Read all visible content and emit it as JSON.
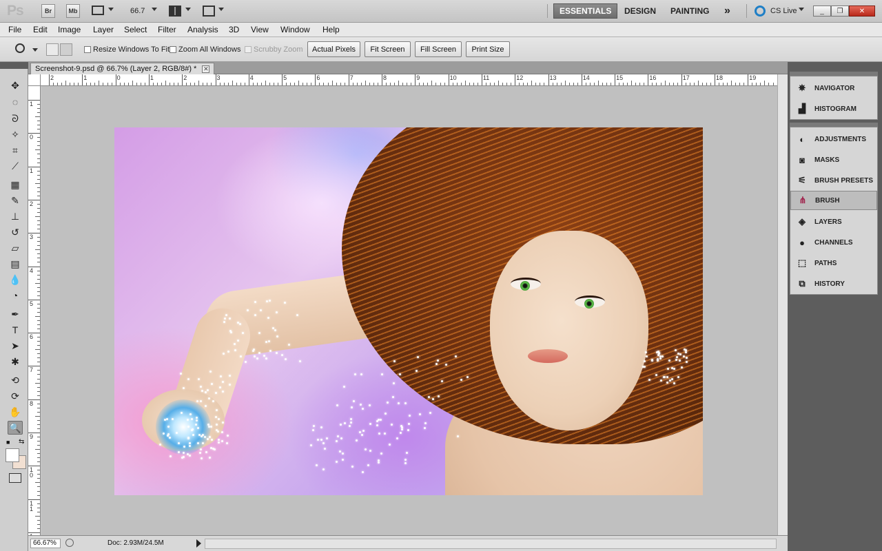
{
  "appbar": {
    "logo": "Ps",
    "bridge_label": "Br",
    "minibridge_label": "Mb",
    "zoom_value": "66.7",
    "workspaces": [
      "ESSENTIALS",
      "DESIGN",
      "PAINTING"
    ],
    "more_symbol": "»",
    "cslive_label": "CS Live"
  },
  "menu": [
    "File",
    "Edit",
    "Image",
    "Layer",
    "Select",
    "Filter",
    "Analysis",
    "3D",
    "View",
    "Window",
    "Help"
  ],
  "options": {
    "resize_windows": "Resize Windows To Fit",
    "zoom_all": "Zoom All Windows",
    "scrubby_zoom": "Scrubby Zoom",
    "actual_pixels": "Actual Pixels",
    "fit_screen": "Fit Screen",
    "fill_screen": "Fill Screen",
    "print_size": "Print Size"
  },
  "document": {
    "tab_title": "Screenshot-9.psd @ 66.7% (Layer 2, RGB/8#) *",
    "ruler_top": [
      "2",
      "1",
      "0",
      "1",
      "2",
      "3",
      "4",
      "5",
      "6",
      "7",
      "8",
      "9",
      "10",
      "11",
      "12",
      "13",
      "14",
      "15",
      "16",
      "17",
      "18",
      "19"
    ],
    "ruler_left": [
      "1",
      "0",
      "1",
      "2",
      "3",
      "4",
      "5",
      "6",
      "7",
      "8",
      "9",
      "1 0",
      "1 1",
      "1 2"
    ],
    "status_zoom": "66.67%",
    "status_doc": "Doc: 2.93M/24.5M"
  },
  "panels": {
    "group1": [
      "NAVIGATOR",
      "HISTOGRAM"
    ],
    "group2": [
      "ADJUSTMENTS",
      "MASKS",
      "BRUSH PRESETS",
      "BRUSH",
      "LAYERS",
      "CHANNELS",
      "PATHS",
      "HISTORY"
    ],
    "active": "BRUSH"
  },
  "colors": {
    "foreground": "#ffffff",
    "background": "#f2e0d2"
  }
}
